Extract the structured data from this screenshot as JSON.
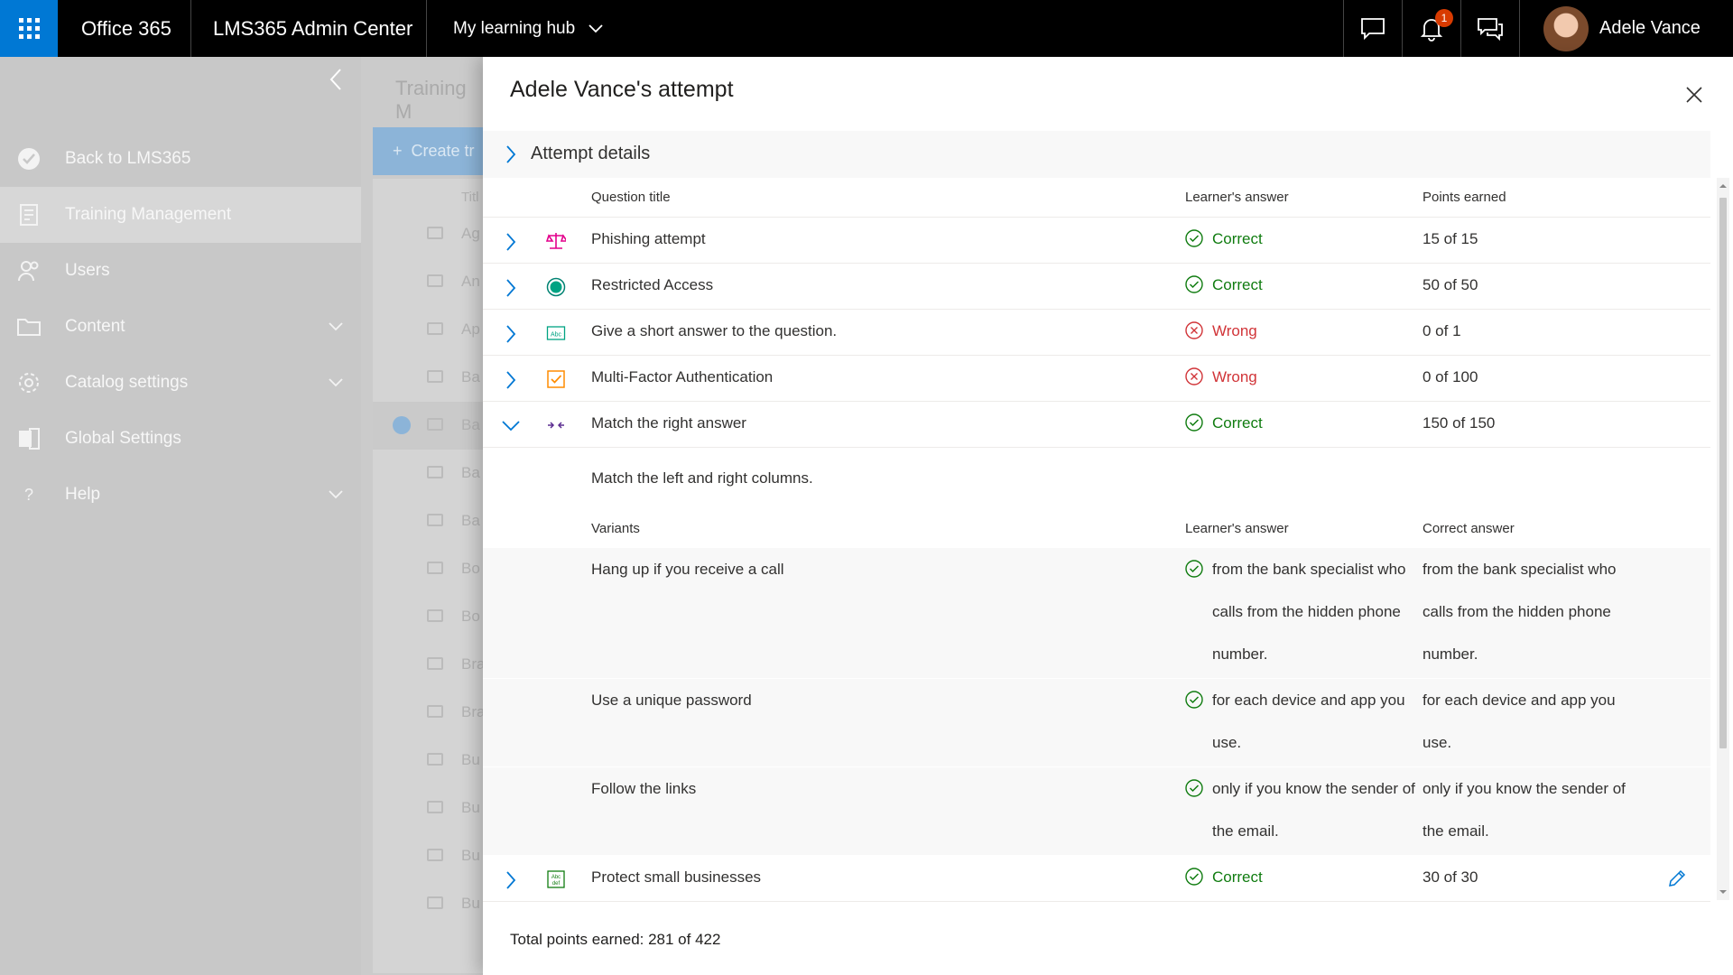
{
  "topbar": {
    "app_name": "Office 365",
    "admin_center": "LMS365 Admin Center",
    "hub_label": "My learning hub",
    "notification_count": "1",
    "user_name": "Adele Vance"
  },
  "leftnav": {
    "items": [
      {
        "label": "Back to LMS365",
        "icon": "back-check-icon"
      },
      {
        "label": "Training Management",
        "icon": "training-icon"
      },
      {
        "label": "Users",
        "icon": "users-icon"
      },
      {
        "label": "Content",
        "icon": "folder-icon"
      },
      {
        "label": "Catalog settings",
        "icon": "gear-icon"
      },
      {
        "label": "Global Settings",
        "icon": "global-settings-icon"
      },
      {
        "label": "Help",
        "icon": "help-icon"
      }
    ]
  },
  "background": {
    "title": "Training M",
    "create_label": "Create tr",
    "column_header": "Titl",
    "rows": [
      "Ag",
      "An",
      "Ap",
      "Ba",
      "Ba",
      "Ba",
      "Ba",
      "Bo",
      "Bo",
      "Bra",
      "Bra",
      "Bu",
      "Bu",
      "Bu",
      "Bu"
    ]
  },
  "panel": {
    "title": "Adele Vance's attempt",
    "attempt_details_label": "Attempt details",
    "columns": {
      "question_title": "Question title",
      "learners_answer": "Learner's answer",
      "points_earned": "Points earned"
    },
    "questions": [
      {
        "title": "Phishing attempt",
        "status": "Correct",
        "points": "15 of 15",
        "icon": "scale-icon"
      },
      {
        "title": "Restricted Access",
        "status": "Correct",
        "points": "50 of 50",
        "icon": "radio-icon"
      },
      {
        "title": "Give a short answer to the question.",
        "status": "Wrong",
        "points": "0 of 1",
        "icon": "abc-icon"
      },
      {
        "title": "Multi-Factor Authentication",
        "status": "Wrong",
        "points": "0 of 100",
        "icon": "checkbox-icon"
      },
      {
        "title": "Match the right answer",
        "status": "Correct",
        "points": "150 of 150",
        "icon": "match-icon"
      }
    ],
    "expanded": {
      "description": "Match the left and right columns.",
      "columns": {
        "variants": "Variants",
        "learners_answer": "Learner's answer",
        "correct_answer": "Correct answer"
      },
      "variants": [
        {
          "variant": "Hang up if you receive a call",
          "learner": "from the bank specialist who calls from the hidden phone number.",
          "correct": "from the bank specialist who calls from the hidden phone number."
        },
        {
          "variant": "Use a unique password",
          "learner": "for each device and app you use.",
          "correct": "for each device and app you use."
        },
        {
          "variant": "Follow the links",
          "learner": "only if you know the sender of the email.",
          "correct": "only if you know the sender of the email."
        }
      ]
    },
    "last_question": {
      "title": "Protect small businesses",
      "status": "Correct",
      "points": "30 of 30",
      "icon": "abc-def-icon"
    },
    "total": "Total points earned: 281 of 422"
  },
  "colors": {
    "brand": "#0078d4",
    "correct": "#107c10",
    "wrong": "#d13438",
    "badge": "#d83b01"
  }
}
